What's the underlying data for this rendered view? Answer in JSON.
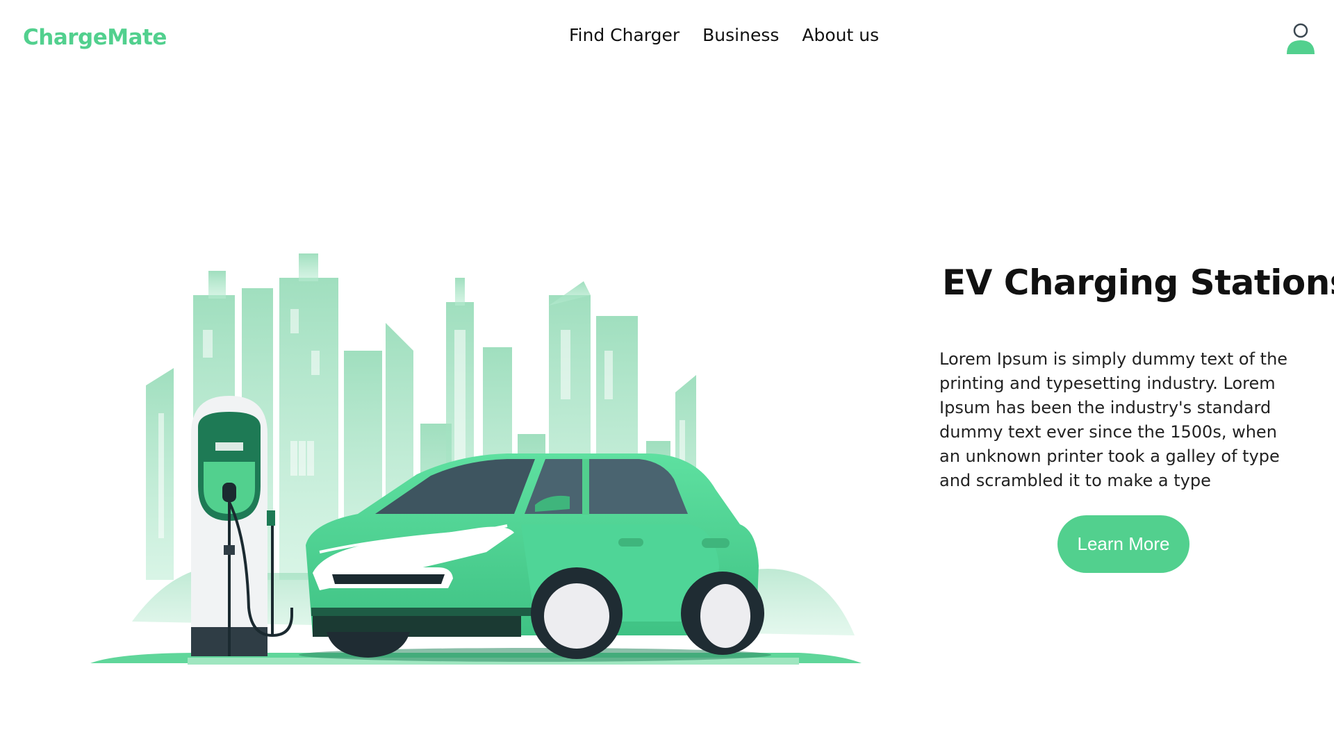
{
  "header": {
    "logo": "ChargeMate",
    "nav": [
      {
        "label": "Find Charger"
      },
      {
        "label": "Business"
      },
      {
        "label": "About us"
      }
    ],
    "user_icon": "user-icon"
  },
  "hero": {
    "title": "EV Charging Stations",
    "body": "Lorem Ipsum is simply dummy text of the printing and typesetting industry. Lorem Ipsum has been the industry's standard dummy text ever since the 1500s, when an unknown printer took a galley of type and scrambled it to make a type",
    "button_label": "Learn More",
    "illustration": "ev-car-charging-city-illustration"
  },
  "colors": {
    "brand": "#52d08e",
    "brand_dark": "#1e7a55",
    "text": "#111111"
  }
}
